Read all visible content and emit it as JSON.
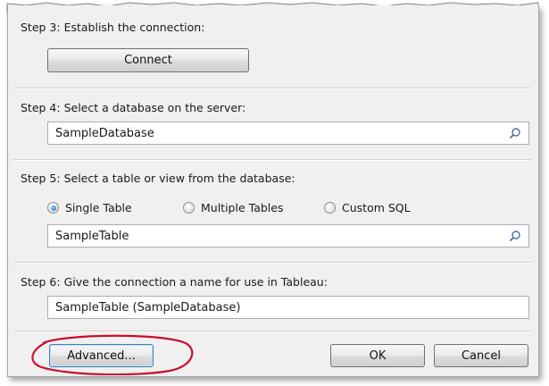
{
  "steps": {
    "step3": {
      "label": "Step 3: Establish the connection:",
      "button": "Connect"
    },
    "step4": {
      "label": "Step 4: Select a database on the server:",
      "value": "SampleDatabase"
    },
    "step5": {
      "label": "Step 5: Select a table or view from the database:",
      "options": [
        "Single Table",
        "Multiple Tables",
        "Custom SQL"
      ],
      "selected": "Single Table",
      "value": "SampleTable"
    },
    "step6": {
      "label": "Step 6: Give the connection a name for use in Tableau:",
      "value": "SampleTable (SampleDatabase)"
    }
  },
  "footer": {
    "advanced": "Advanced...",
    "ok": "OK",
    "cancel": "Cancel"
  },
  "colors": {
    "highlight_ellipse": "#c8102e",
    "radio_selected": "#1a5fb4"
  }
}
